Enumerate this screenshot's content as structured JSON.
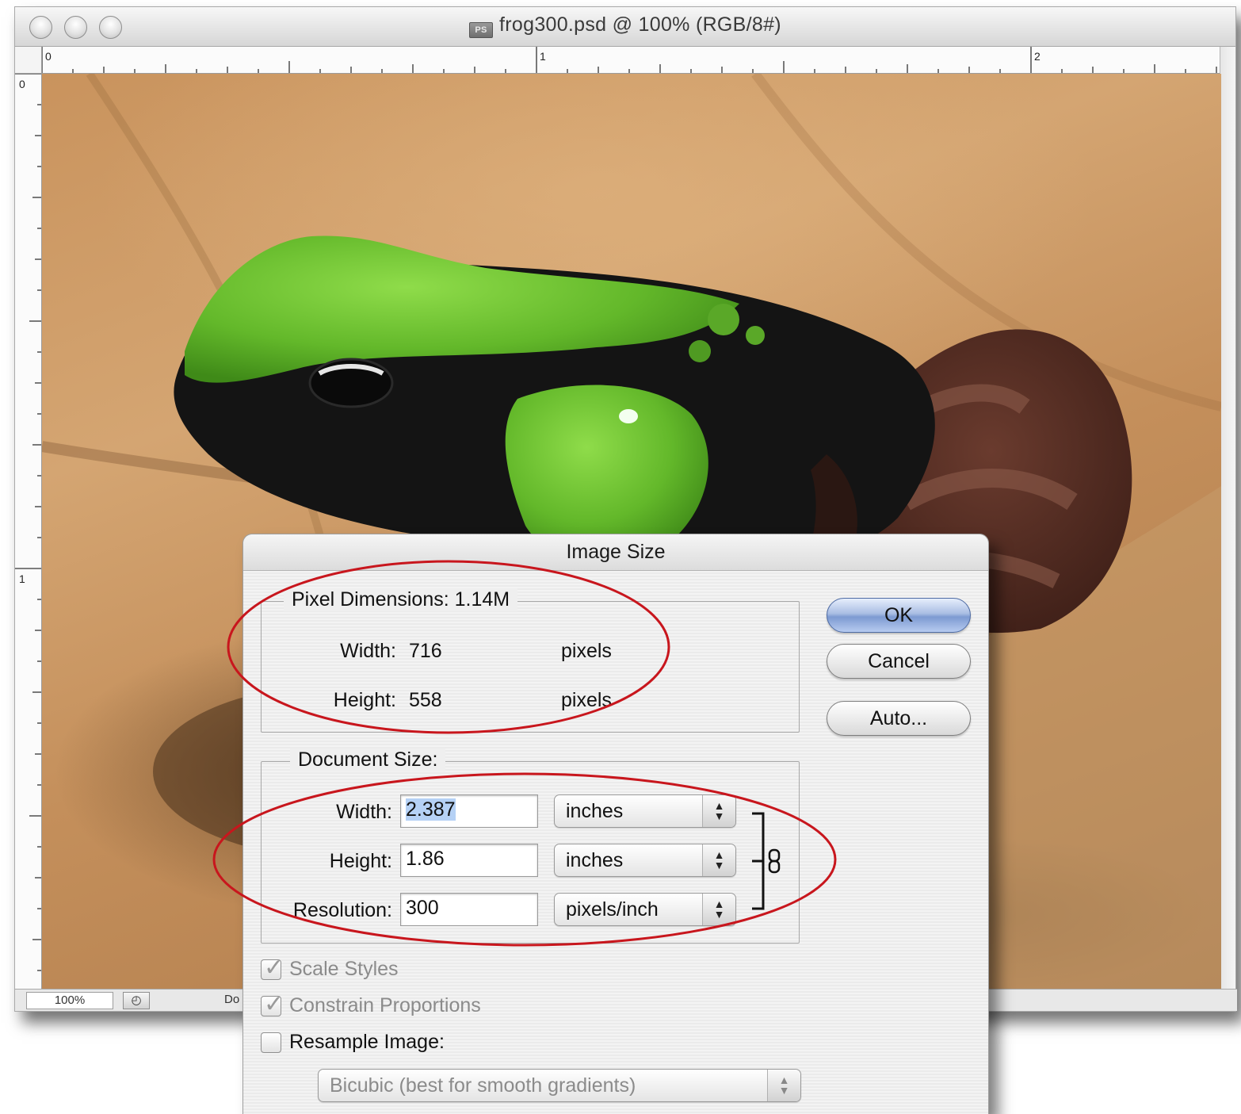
{
  "document_window": {
    "title": "frog300.psd @ 100% (RGB/8#)",
    "file_icon": "PS",
    "ruler_top_labels": [
      "0",
      "1",
      "2"
    ],
    "ruler_left_labels": [
      "0",
      "1"
    ],
    "zoom": "100%",
    "status_text": "Do"
  },
  "dialog": {
    "title": "Image Size",
    "pixel_dimensions": {
      "legend": "Pixel Dimensions:  1.14M",
      "width_label": "Width:",
      "width_value": "716",
      "width_unit": "pixels",
      "height_label": "Height:",
      "height_value": "558",
      "height_unit": "pixels"
    },
    "document_size": {
      "legend": "Document Size:",
      "width_label": "Width:",
      "width_value": "2.387",
      "width_unit": "inches",
      "height_label": "Height:",
      "height_value": "1.86",
      "height_unit": "inches",
      "resolution_label": "Resolution:",
      "resolution_value": "300",
      "resolution_unit": "pixels/inch"
    },
    "buttons": {
      "ok": "OK",
      "cancel": "Cancel",
      "auto": "Auto..."
    },
    "options": {
      "scale_styles": {
        "label": "Scale Styles",
        "checked": true,
        "enabled": false
      },
      "constrain_proportions": {
        "label": "Constrain Proportions",
        "checked": true,
        "enabled": false
      },
      "resample_image": {
        "label": "Resample Image:",
        "checked": false,
        "enabled": true
      }
    },
    "resample_method": "Bicubic (best for smooth gradients)"
  },
  "colors": {
    "highlight_ellipse": "#c8161d",
    "text_selection": "#b5d1f5",
    "default_button": "#7d9ad1"
  },
  "icons": {
    "traffic_lights": "window-control-icon",
    "link_chain": "chain-link-icon",
    "popup_arrows": "up-down-arrows-icon",
    "checkmark": "checkmark-icon"
  }
}
